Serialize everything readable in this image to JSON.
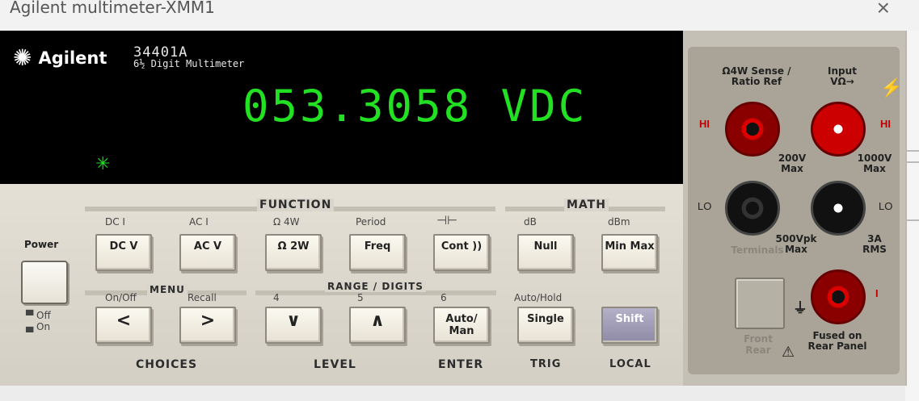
{
  "window": {
    "title": "Agilent multimeter-XMM1",
    "close_symbol": "×"
  },
  "display": {
    "brand": "Agilent",
    "model": "34401A",
    "model_sub": "6½ Digit Multimeter",
    "reading": "053.3058 VDC",
    "annunciator": "✳"
  },
  "power": {
    "label": "Power",
    "off": "Off",
    "on": "On"
  },
  "groups": {
    "function": "FUNCTION",
    "math": "MATH",
    "menu": "MENU",
    "range": "RANGE / DIGITS"
  },
  "shift_labels": {
    "dc_i": "DC I",
    "ac_i": "AC I",
    "ohm4w": "Ω 4W",
    "period": "Period",
    "diode": "⊣⊢",
    "db": "dB",
    "dbm": "dBm",
    "on_off": "On/Off",
    "recall": "Recall",
    "digit4": "4",
    "digit5": "5",
    "digit6": "6",
    "auto_hold": "Auto/Hold"
  },
  "buttons": {
    "dc_v": "DC V",
    "ac_v": "AC V",
    "ohm2w": "Ω 2W",
    "freq": "Freq",
    "cont": "Cont ))",
    "null": "Null",
    "minmax": "Min Max",
    "left": "<",
    "right": ">",
    "down": "∨",
    "up": "∧",
    "auto_man": "Auto/ Man",
    "single": "Single",
    "shift": "Shift"
  },
  "bottom_labels": {
    "choices": "CHOICES",
    "level": "LEVEL",
    "enter": "ENTER",
    "trig": "TRIG",
    "local": "LOCAL"
  },
  "jacks": {
    "sense_label": "Ω4W Sense / Ratio Ref",
    "input_label": "Input VΩ→",
    "hi": "HI",
    "lo": "LO",
    "max200": "200V Max",
    "max1000": "1000V Max",
    "max500": "500Vpk Max",
    "amps": "3A RMS",
    "current": "I",
    "terminals": "Terminals",
    "front": "Front",
    "rear": "Rear",
    "fused": "Fused on Rear Panel"
  }
}
